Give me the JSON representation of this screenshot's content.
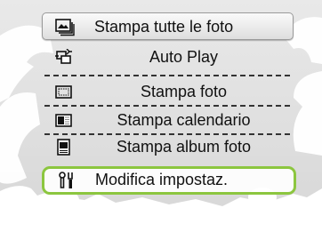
{
  "menu": {
    "items": [
      {
        "label": "Stampa tutte le foto",
        "icon": "print-all-photos-icon",
        "state": "highlighted"
      },
      {
        "label": "Auto Play",
        "icon": "auto-play-icon"
      },
      {
        "label": "Stampa foto",
        "icon": "print-photo-icon"
      },
      {
        "label": "Stampa calendario",
        "icon": "print-calendar-icon"
      },
      {
        "label": "Stampa album foto",
        "icon": "print-album-icon"
      },
      {
        "label": "Modifica impostaz.",
        "icon": "settings-tools-icon",
        "state": "selected"
      }
    ]
  },
  "colors": {
    "selection_border": "#8cc63f",
    "background_gray": "#d6d6d6",
    "silhouette_white": "#ffffff"
  }
}
